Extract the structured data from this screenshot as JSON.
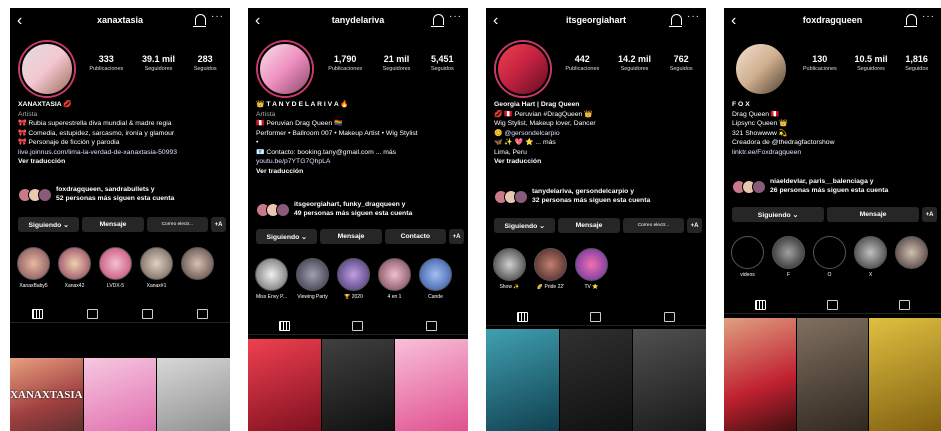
{
  "profiles": [
    {
      "username": "xanaxtasia",
      "stats": [
        {
          "value": "333",
          "label": "Publicaciones"
        },
        {
          "value": "39.1 mil",
          "label": "Seguidores"
        },
        {
          "value": "283",
          "label": "Seguidos"
        }
      ],
      "bio": [
        "XANAXTASIA 💋",
        "Artista",
        "🎀 Rubia superestrella diva mundial & madre regia",
        "🎀 Comedia, estupidez, sarcasmo, ironía y glamour",
        "🎀 Personaje de ficción y parodia",
        "live.joinnus.com/lima-la-verdad-de-xanaxtasia-50993",
        "Ver traducción"
      ],
      "followed_names": "foxdragqueen, sandrabullets y",
      "followed_rest": "52 personas más siguen esta cuenta",
      "buttons": [
        "Siguiendo ⌄",
        "Mensaje",
        "Correo electr...",
        "+A"
      ],
      "highlights": [
        "XanaxBaby5",
        "Xanax42",
        "LVDX-5",
        "Xanax#1",
        ""
      ],
      "post_title": "XANAXTASIA"
    },
    {
      "username": "tanydelariva",
      "stats": [
        {
          "value": "1,790",
          "label": "Publicaciones"
        },
        {
          "value": "21 mil",
          "label": "Seguidores"
        },
        {
          "value": "5,451",
          "label": "Seguidos"
        }
      ],
      "bio": [
        "👑 T A N Y  D E  L A  R I V A 🔥",
        "Artista",
        "🇵🇪 Peruvian Drag Queen 🏳️‍🌈",
        "Performer • Ballroom 007 • Makeup Artist • Wig Stylist",
        "•",
        "📧 Contacto: booking.tany@gmail.com ... más",
        "youtu.be/p7YTG7QhpLA",
        "Ver traducción"
      ],
      "followed_names": "itsgeorgiahart, funky_dragqueen y",
      "followed_rest": "49 personas más siguen esta cuenta",
      "buttons": [
        "Siguiendo ⌄",
        "Mensaje",
        "Contacto",
        "+A"
      ],
      "highlights": [
        "Miss Envy P...",
        "Viewing Party",
        "🏆 2020",
        "4 en 1",
        "Cande"
      ]
    },
    {
      "username": "itsgeorgiahart",
      "stats": [
        {
          "value": "442",
          "label": "Publicaciones"
        },
        {
          "value": "14.2 mil",
          "label": "Seguidores"
        },
        {
          "value": "762",
          "label": "Seguidos"
        }
      ],
      "bio": [
        "Georgia Hart | Drag Queen",
        "💋 🇵🇪 Peruvian #DragQueen 👑",
        "Wig Stylist, Makeup lover, Dancer",
        "😊 @gersondelcarpio",
        "🦋 ✨ 💖 ⭐ ... más",
        "Lima, Peru",
        "Ver traducción"
      ],
      "followed_names": "tanydelariva, gersondelcarpio y",
      "followed_rest": "32 personas más siguen esta cuenta",
      "buttons": [
        "Siguiendo ⌄",
        "Mensaje",
        "Correo electr...",
        "+A"
      ],
      "highlights": [
        "Show ✨",
        "🌈 Pride 22'",
        "TV ⭐"
      ]
    },
    {
      "username": "foxdragqueen",
      "stats": [
        {
          "value": "130",
          "label": "Publicaciones"
        },
        {
          "value": "10.5 mil",
          "label": "Seguidores"
        },
        {
          "value": "1,816",
          "label": "Seguidos"
        }
      ],
      "bio": [
        "F O X",
        "Drag Queen 🇵🇪",
        "Lipsync Queen 👑",
        "321 Showwww 💫",
        "Creadora de @thedragfactorshow",
        "linktr.ee/Foxdragqueen"
      ],
      "followed_names": "niaeldevlar, paris__balenciaga y",
      "followed_rest": "26 personas más siguen esta cuenta",
      "buttons": [
        "Siguiendo ⌄",
        "Mensaje",
        "+A"
      ],
      "highlights": [
        "videos",
        "F",
        "O",
        "X",
        ""
      ]
    }
  ],
  "colors": {
    "background": "#000000",
    "button": "#262626",
    "ring": "#c93a6b"
  }
}
